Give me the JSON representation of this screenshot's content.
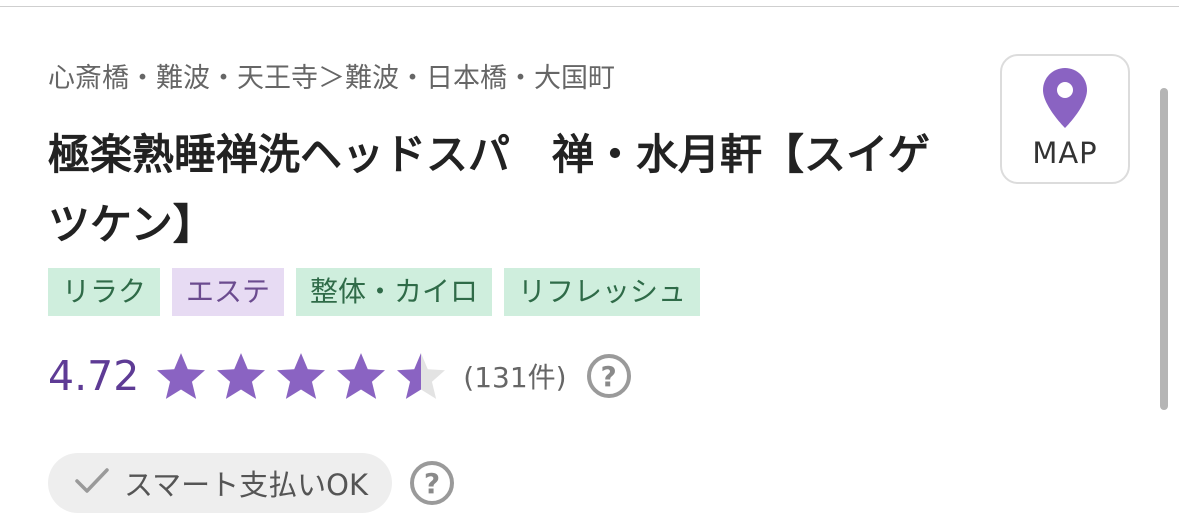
{
  "breadcrumb": "心斎橋・難波・天王寺＞難波・日本橋・大国町",
  "title": "極楽熟睡禅洗ヘッドスパ　禅・水月軒【スイゲツケン】",
  "tags": [
    {
      "label": "リラク",
      "style": "green"
    },
    {
      "label": "エステ",
      "style": "purple"
    },
    {
      "label": "整体・カイロ",
      "style": "green"
    },
    {
      "label": "リフレッシュ",
      "style": "green"
    }
  ],
  "rating": {
    "score": "4.72",
    "stars_filled": 4.5,
    "stars_total": 5,
    "review_count": "(131件)"
  },
  "help_icon": "?",
  "payment": {
    "label": "スマート支払いOK"
  },
  "map_button": {
    "label": "MAP"
  },
  "colors": {
    "accent_purple": "#8a63c2",
    "score_purple": "#5e3b95",
    "tag_green_bg": "#cfeedd",
    "tag_purple_bg": "#e7dbf3"
  }
}
